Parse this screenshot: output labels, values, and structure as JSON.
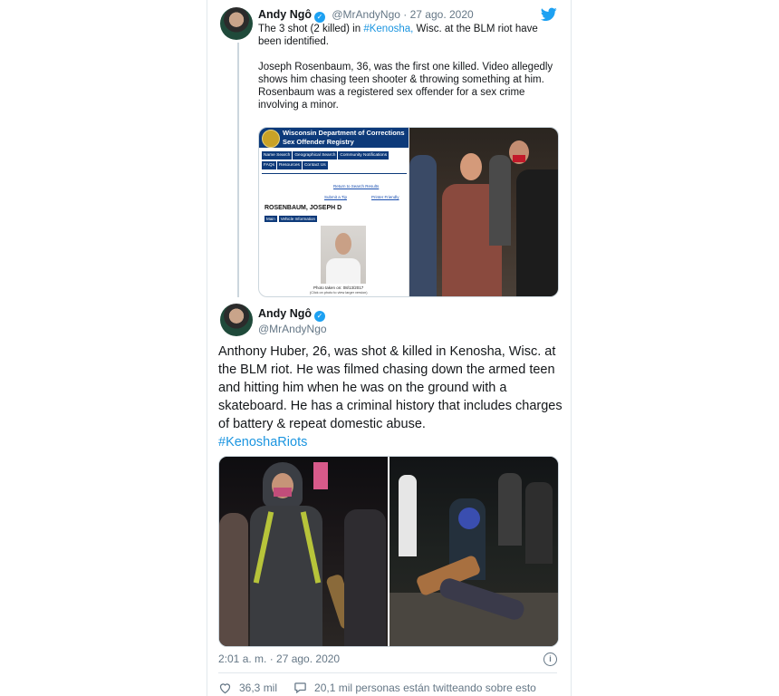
{
  "quoted_tweet": {
    "author_name": "Andy Ngô",
    "handle": "@MrAndyNgo",
    "separator": "·",
    "date": "27 ago. 2020",
    "text_line1_pre": "The 3 shot (2 killed) in ",
    "text_line1_hashtag": "#Kenosha,",
    "text_line1_post": " Wisc. at the BLM riot have been identified.",
    "text_paragraph2": "Joseph Rosenbaum, 36, was the first one killed. Video allegedly shows him chasing teen shooter & throwing something at him. Rosenbaum was a registered sex offender for a sex crime involving a minor.",
    "registry": {
      "title_line1": "Wisconsin Department of Corrections",
      "title_line2": "Sex Offender Registry",
      "nav": [
        "Name Search",
        "Geographical Search",
        "Community Notifications",
        "FAQs",
        "Resources",
        "Contact Us"
      ],
      "return_link": "Return to Search Results",
      "submit_tip": "Submit a Tip",
      "printer_friendly": "Printer Friendly",
      "person_name": "ROSENBAUM, JOSEPH D",
      "tabs": [
        "Main",
        "Vehicle Information"
      ],
      "photo_caption": "Photo taken on: 08/13/2017",
      "photo_subcaption": "(Click on photo to view larger version)"
    }
  },
  "main_tweet": {
    "author_name": "Andy Ngô",
    "handle": "@MrAndyNgo",
    "text": "Anthony Huber, 26, was shot & killed in Kenosha, Wisc. at the BLM riot. He was filmed chasing down the armed teen and hitting him when he was on the ground with a skateboard. He has a criminal history that includes charges of battery & repeat domestic abuse.",
    "hashtag": "#KenoshaRiots",
    "timestamp": "2:01 a. m. · 27 ago. 2020",
    "likes": "36,3 mil",
    "talking": "20,1 mil personas están twitteando sobre esto"
  },
  "colors": {
    "link": "#1b95e0",
    "twitter_blue": "#1da1f2",
    "like_red": "#e0245e",
    "muted": "#657786"
  },
  "icons": {
    "brand": "twitter-bird-icon",
    "verified": "verified-badge-icon",
    "like": "heart-icon",
    "reply": "speech-bubble-icon",
    "info": "info-icon"
  }
}
